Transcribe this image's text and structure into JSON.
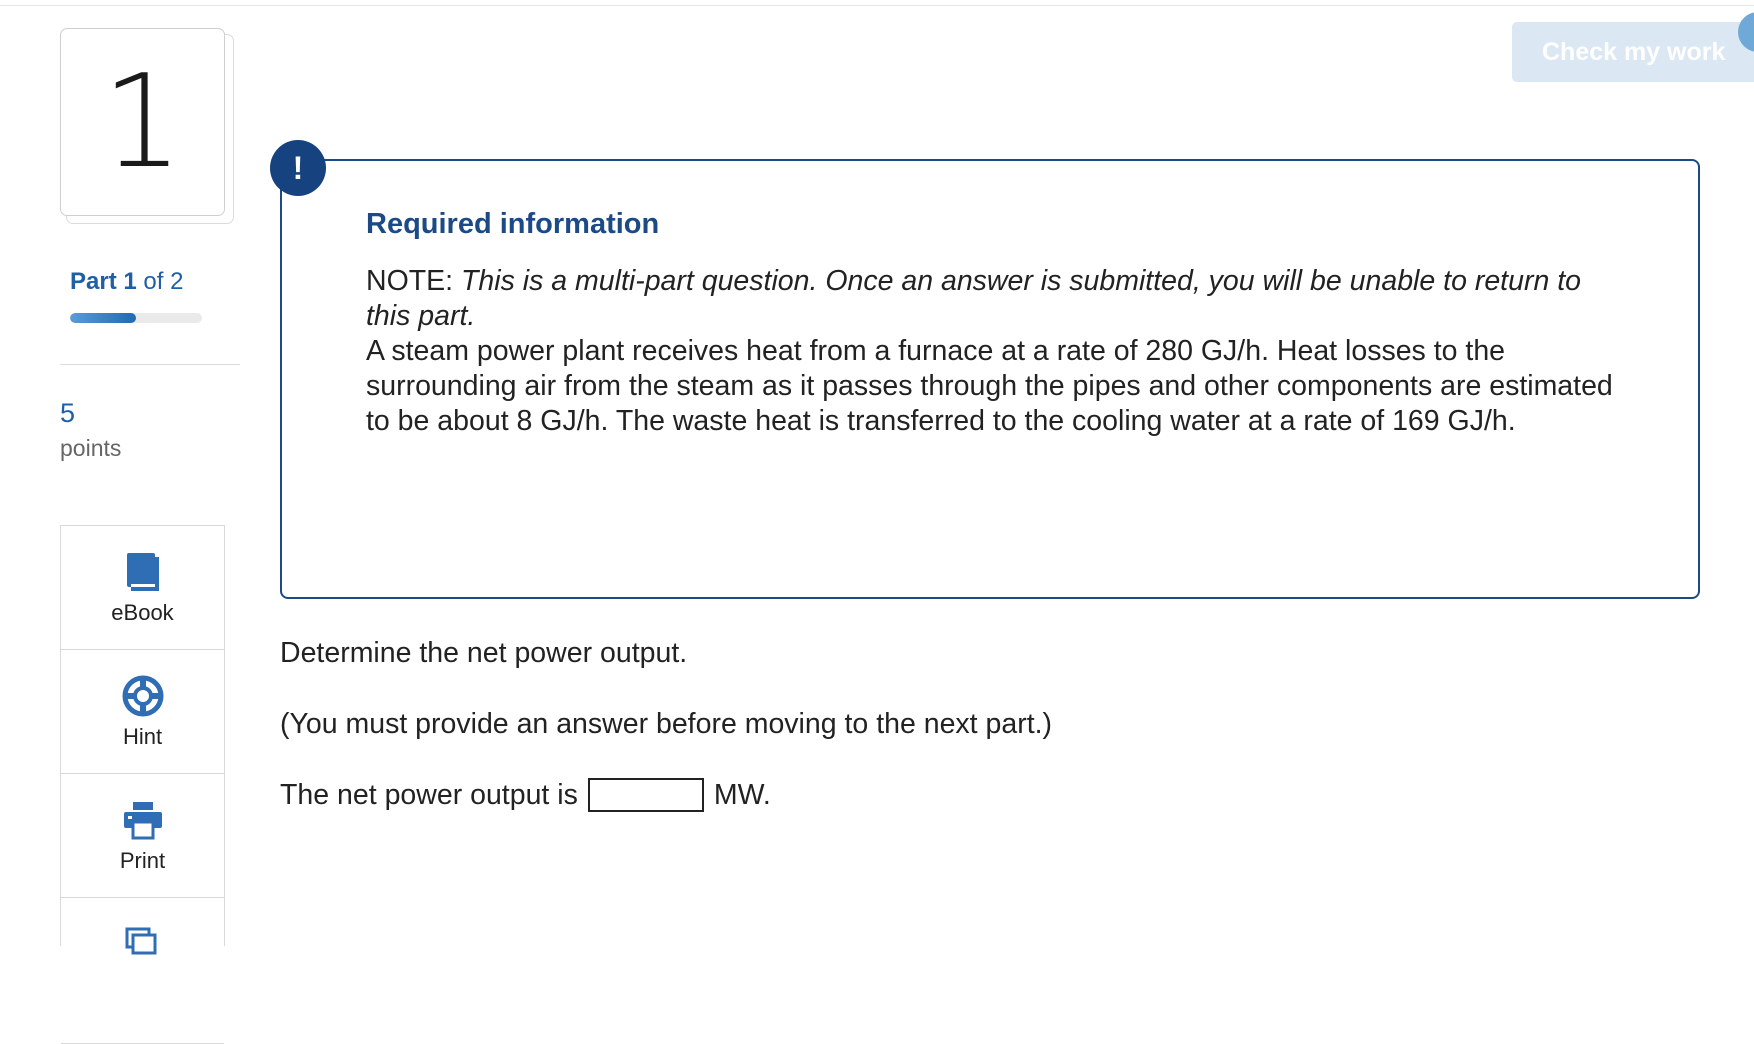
{
  "question": {
    "number": "1"
  },
  "part": {
    "prefix": "Part",
    "current": "1",
    "of_text": "of 2",
    "progress": 0.5
  },
  "points": {
    "value": "5",
    "label": "points"
  },
  "tools": [
    {
      "label": "eBook",
      "icon": "ebook-icon"
    },
    {
      "label": "Hint",
      "icon": "hint-lifebuoy-icon"
    },
    {
      "label": "Print",
      "icon": "print-icon"
    },
    {
      "label": "",
      "icon": "references-icon"
    }
  ],
  "check_button": {
    "label": "Check my work"
  },
  "info_box": {
    "badge": "!",
    "title": "Required information",
    "note_prefix": "NOTE:",
    "note_text": "This is a multi-part question. Once an answer is submitted, you will be unable to return to this part.",
    "body": "A steam power plant receives heat from a furnace at a rate of 280 GJ/h. Heat losses to the surrounding air from the steam as it passes through the pipes and other components are estimated to be about 8 GJ/h. The waste heat is transferred to the cooling water at a rate of 169 GJ/h."
  },
  "prompt": {
    "question": "Determine the net power output.",
    "requirement": "(You must provide an answer before moving to the next part.)",
    "answer_prefix": "The net power output is",
    "answer_value": "",
    "answer_unit": "MW."
  },
  "colors": {
    "brand_blue": "#1b4a86",
    "link_blue": "#1f5fa6",
    "button_disabled": "#dbe7f3"
  }
}
